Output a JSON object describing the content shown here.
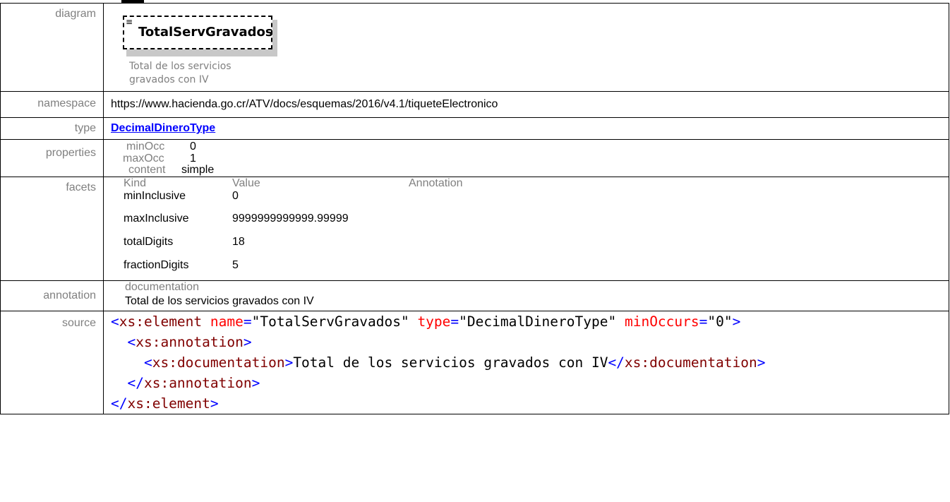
{
  "labels": {
    "diagram": "diagram",
    "namespace": "namespace",
    "type": "type",
    "properties": "properties",
    "facets": "facets",
    "annotation": "annotation",
    "source": "source"
  },
  "diagram": {
    "element_name": "TotalServGravados",
    "doc_line1": "Total de los servicios",
    "doc_line2": "gravados con IV"
  },
  "namespace": "https://www.hacienda.go.cr/ATV/docs/esquemas/2016/v4.1/tiqueteElectronico",
  "type_link": "DecimalDineroType",
  "properties": [
    {
      "key": "minOcc",
      "value": "0"
    },
    {
      "key": "maxOcc",
      "value": "1"
    },
    {
      "key": "content",
      "value": "simple"
    }
  ],
  "facets": {
    "headers": {
      "kind": "Kind",
      "value": "Value",
      "annotation": "Annotation"
    },
    "rows": [
      {
        "kind": "minInclusive",
        "value": "0"
      },
      {
        "kind": "maxInclusive",
        "value": "9999999999999.99999"
      },
      {
        "kind": "totalDigits",
        "value": "18"
      },
      {
        "kind": "fractionDigits",
        "value": "5"
      }
    ]
  },
  "annotation": {
    "header": "documentation",
    "text": "Total de los servicios gravados con IV"
  },
  "source": {
    "line1": {
      "open": "<",
      "tag": "xs:element",
      "a1": "name",
      "v1": "\"TotalServGravados\"",
      "a2": "type",
      "v2": "\"DecimalDineroType\"",
      "a3": "minOccurs",
      "v3": "\"0\"",
      "close": ">"
    },
    "line2": {
      "open": "<",
      "tag": "xs:annotation",
      "close": ">"
    },
    "line3": {
      "open": "<",
      "tag": "xs:documentation",
      "close": ">",
      "text": "Total de los servicios gravados con IV",
      "open2": "</",
      "tag2": "xs:documentation",
      "close2": ">"
    },
    "line4": {
      "open": "</",
      "tag": "xs:annotation",
      "close": ">"
    },
    "line5": {
      "open": "</",
      "tag": "xs:element",
      "close": ">"
    }
  }
}
